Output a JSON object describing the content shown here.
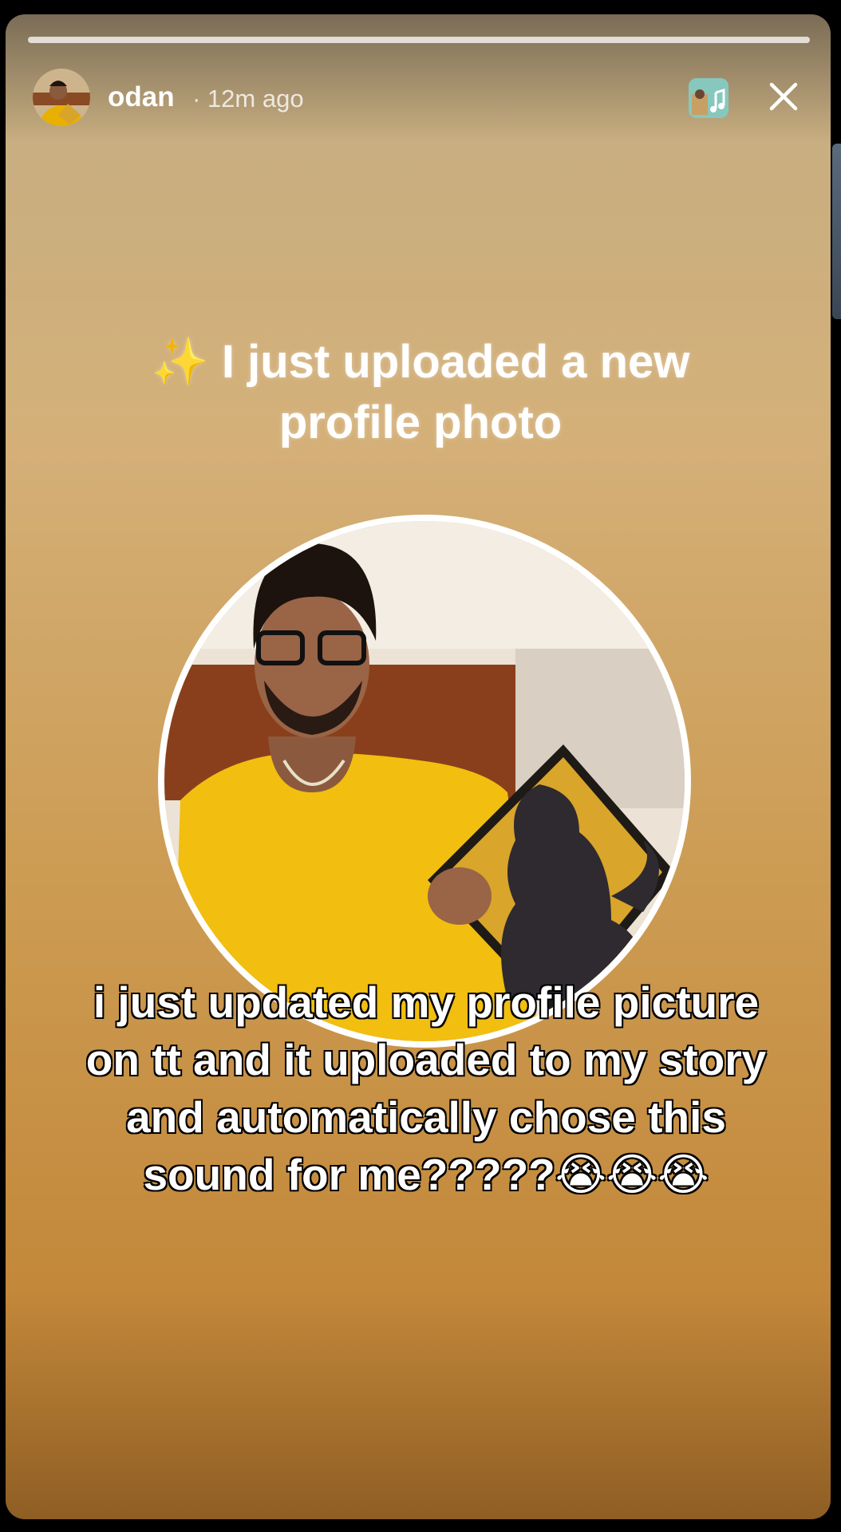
{
  "story": {
    "username": "odan",
    "timestamp": "· 12m ago",
    "progress": 1.0,
    "headline_sparkle": "✨",
    "headline": "I just uploaded a new profile photo",
    "caption": "i just updated my profile picture on tt and it uploaded to my story and automatically chose this sound for me?????😭😭😭"
  },
  "icons": {
    "avatar": "user-avatar",
    "music": "music-note-icon",
    "close": "close-icon"
  },
  "colors": {
    "background_top": "#c8ae80",
    "background_bottom": "#c3883a",
    "text": "#ffffff",
    "music_button": "#7ec3b8"
  }
}
